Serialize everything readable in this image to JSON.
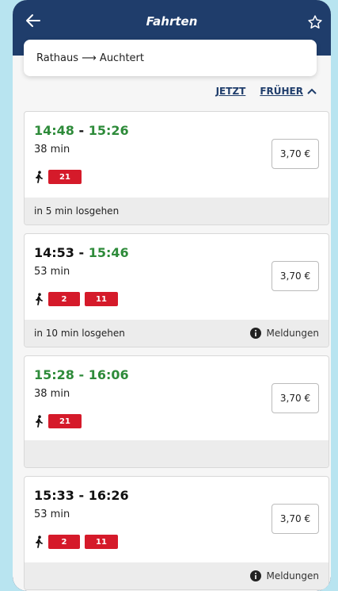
{
  "header": {
    "title": "Fahrten"
  },
  "route": {
    "text": "Rathaus ⟶ Auchtert"
  },
  "filters": {
    "now": "JETZT",
    "earlier": "FRÜHER"
  },
  "trips": [
    {
      "dep": "14:48",
      "sep": " - ",
      "arr": "15:26",
      "dep_green": true,
      "arr_green": true,
      "duration": "38 min",
      "price": "3,70 €",
      "lines": [
        "21"
      ],
      "footer_text": "in 5 min losgehen",
      "notice": ""
    },
    {
      "dep": "14:53",
      "sep": " - ",
      "arr": "15:46",
      "dep_green": false,
      "arr_green": true,
      "duration": "53 min",
      "price": "3,70 €",
      "lines": [
        "2",
        "11"
      ],
      "footer_text": "in 10 min losgehen",
      "notice": "Meldungen"
    },
    {
      "dep": "15:28",
      "sep": " - ",
      "arr": "16:06",
      "dep_green": true,
      "arr_green": true,
      "duration": "38 min",
      "price": "3,70 €",
      "lines": [
        "21"
      ],
      "footer_text": "",
      "notice": ""
    },
    {
      "dep": "15:33",
      "sep": " - ",
      "arr": "16:26",
      "dep_green": false,
      "arr_green": false,
      "duration": "53 min",
      "price": "3,70 €",
      "lines": [
        "2",
        "11"
      ],
      "footer_text": "",
      "notice": "Meldungen"
    }
  ],
  "colors": {
    "header": "#1f3d6b",
    "green": "#2e8b3a",
    "line_badge": "#d51a2a"
  },
  "icons": {
    "back": "arrow-left-icon",
    "favorite": "star-outline-icon",
    "walk": "walk-icon",
    "info": "info-icon",
    "chevron": "chevron-up-icon"
  }
}
